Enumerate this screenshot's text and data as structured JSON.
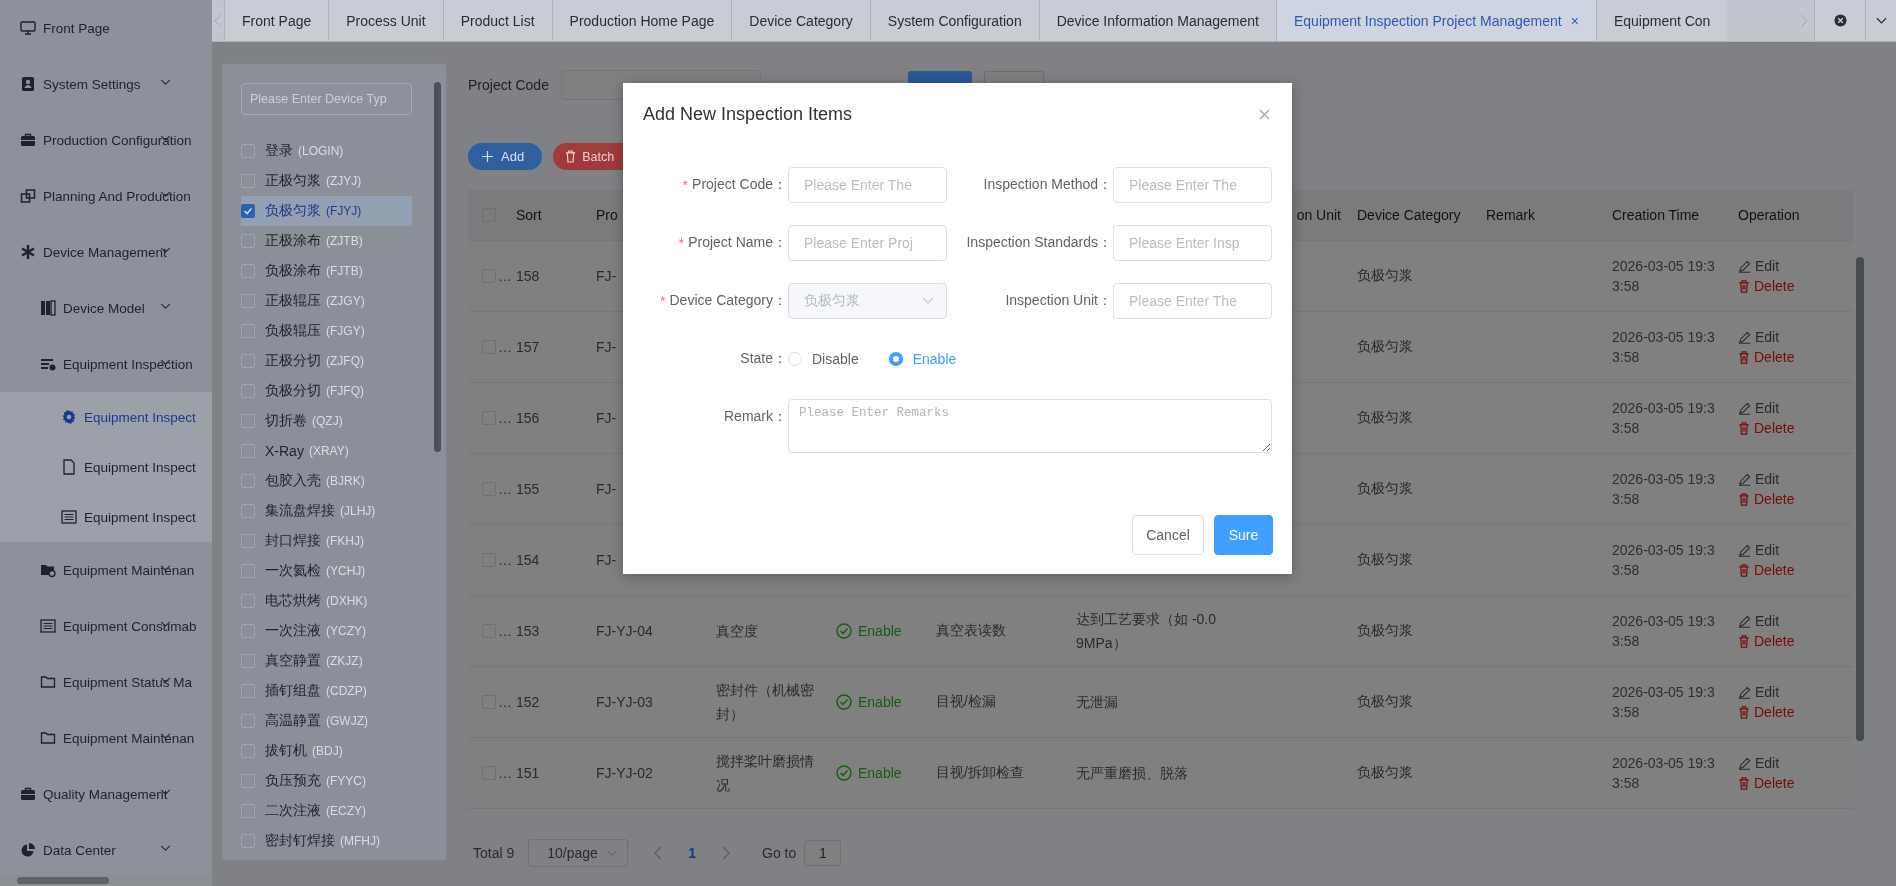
{
  "sidebar": {
    "items": [
      {
        "label": "Front Page",
        "selected": false,
        "expandable": false
      },
      {
        "label": "System Settings",
        "selected": false,
        "expandable": true
      },
      {
        "label": "Production Configuration",
        "selected": false,
        "expandable": true
      },
      {
        "label": "Planning And Production",
        "selected": false,
        "expandable": true
      },
      {
        "label": "Device Management",
        "selected": false,
        "expandable": true,
        "children": [
          {
            "label": "Device Model",
            "selected": false,
            "expandable": true
          },
          {
            "label": "Equipment Inspection",
            "selected": false,
            "expandable": true,
            "children": [
              {
                "label": "Equipment Inspect",
                "selected": true,
                "expandable": false
              },
              {
                "label": "Equipment Inspect",
                "selected": false,
                "expandable": false
              },
              {
                "label": "Equipment Inspect",
                "selected": false,
                "expandable": false
              }
            ]
          },
          {
            "label": "Equipment Maintenan",
            "selected": false,
            "expandable": true
          },
          {
            "label": "Equipment Consumab",
            "selected": false,
            "expandable": true
          },
          {
            "label": "Equipment Status Ma",
            "selected": false,
            "expandable": true
          },
          {
            "label": "Equipment Maintenan",
            "selected": false,
            "expandable": true
          }
        ]
      },
      {
        "label": "Quality Management",
        "selected": false,
        "expandable": true
      },
      {
        "label": "Data Center",
        "selected": false,
        "expandable": true
      }
    ]
  },
  "tabs": [
    {
      "label": "Front Page",
      "selected": false
    },
    {
      "label": "Process Unit",
      "selected": false
    },
    {
      "label": "Product List",
      "selected": false
    },
    {
      "label": "Production Home Page",
      "selected": false
    },
    {
      "label": "Device Category",
      "selected": false
    },
    {
      "label": "System Configuration",
      "selected": false
    },
    {
      "label": "Device Information Management",
      "selected": false
    },
    {
      "label": "Equipment Inspection Project Management",
      "selected": true,
      "close": "×"
    },
    {
      "label": "Equipment Con",
      "selected": false
    }
  ],
  "device_types": {
    "placeholder": "Please Enter Device Typ",
    "items": [
      {
        "name": "登录",
        "code": "(LOGIN)",
        "checked": false
      },
      {
        "name": "正极匀浆",
        "code": "(ZJYJ)",
        "checked": false
      },
      {
        "name": "负极匀浆",
        "code": "(FJYJ)",
        "checked": true
      },
      {
        "name": "正极涂布",
        "code": "(ZJTB)",
        "checked": false
      },
      {
        "name": "负极涂布",
        "code": "(FJTB)",
        "checked": false
      },
      {
        "name": "正极辊压",
        "code": "(ZJGY)",
        "checked": false
      },
      {
        "name": "负极辊压",
        "code": "(FJGY)",
        "checked": false
      },
      {
        "name": "正极分切",
        "code": "(ZJFQ)",
        "checked": false
      },
      {
        "name": "负极分切",
        "code": "(FJFQ)",
        "checked": false
      },
      {
        "name": "切折卷",
        "code": "(QZJ)",
        "checked": false
      },
      {
        "name": "X-Ray",
        "code": "(XRAY)",
        "checked": false
      },
      {
        "name": "包胶入壳",
        "code": "(BJRK)",
        "checked": false
      },
      {
        "name": "集流盘焊接",
        "code": "(JLHJ)",
        "checked": false
      },
      {
        "name": "封口焊接",
        "code": "(FKHJ)",
        "checked": false
      },
      {
        "name": "一次氦检",
        "code": "(YCHJ)",
        "checked": false
      },
      {
        "name": "电芯烘烤",
        "code": "(DXHK)",
        "checked": false
      },
      {
        "name": "一次注液",
        "code": "(YCZY)",
        "checked": false
      },
      {
        "name": "真空静置",
        "code": "(ZKJZ)",
        "checked": false
      },
      {
        "name": "插钉组盘",
        "code": "(CDZP)",
        "checked": false
      },
      {
        "name": "高温静置",
        "code": "(GWJZ)",
        "checked": false
      },
      {
        "name": "拔钉机",
        "code": "(BDJ)",
        "checked": false
      },
      {
        "name": "负压预充",
        "code": "(FYYC)",
        "checked": false
      },
      {
        "name": "二次注液",
        "code": "(ECZY)",
        "checked": false
      },
      {
        "name": "密封钉焊接",
        "code": "(MFHJ)",
        "checked": false
      }
    ]
  },
  "filter": {
    "label": "Project Code"
  },
  "toolbar": [
    {
      "label": "Add",
      "kind": "add"
    },
    {
      "label": "Batch",
      "kind": "delete"
    }
  ],
  "table": {
    "all_checked": false,
    "columns": {
      "sort": "Sort",
      "column_3": "Pro",
      "column_8": "on Unit",
      "device_category": "Device Category",
      "remark": "Remark",
      "creation_time": "Creation Time",
      "operation": "Operation"
    },
    "rows": [
      {
        "checked": false,
        "ellipsis": "…",
        "sort": "158",
        "project_code": "FJ-",
        "device_category": "负极匀浆",
        "creation_time": "2026-03-05 19:33:58",
        "actions": [
          {
            "label": "Edit",
            "kind": "edit"
          },
          {
            "label": "Delete",
            "kind": "delete"
          }
        ]
      },
      {
        "checked": false,
        "ellipsis": "…",
        "sort": "157",
        "project_code": "FJ-",
        "device_category": "负极匀浆",
        "creation_time": "2026-03-05 19:33:58",
        "actions": [
          {
            "label": "Edit",
            "kind": "edit"
          },
          {
            "label": "Delete",
            "kind": "delete"
          }
        ]
      },
      {
        "checked": false,
        "ellipsis": "…",
        "sort": "156",
        "project_code": "FJ-",
        "device_category": "负极匀浆",
        "creation_time": "2026-03-05 19:33:58",
        "actions": [
          {
            "label": "Edit",
            "kind": "edit"
          },
          {
            "label": "Delete",
            "kind": "delete"
          }
        ]
      },
      {
        "checked": false,
        "ellipsis": "…",
        "sort": "155",
        "project_code": "FJ-",
        "device_category": "负极匀浆",
        "creation_time": "2026-03-05 19:33:58",
        "actions": [
          {
            "label": "Edit",
            "kind": "edit"
          },
          {
            "label": "Delete",
            "kind": "delete"
          }
        ]
      },
      {
        "checked": false,
        "ellipsis": "…",
        "sort": "154",
        "project_code": "FJ-",
        "device_category": "负极匀浆",
        "creation_time": "2026-03-05 19:33:58",
        "actions": [
          {
            "label": "Edit",
            "kind": "edit"
          },
          {
            "label": "Delete",
            "kind": "delete"
          }
        ]
      },
      {
        "checked": false,
        "ellipsis": "…",
        "sort": "153",
        "project_code": "FJ-YJ-04",
        "project_name": "真空度",
        "state": {
          "label": "Enable",
          "enabled": true
        },
        "inspection_method": "真空表读数",
        "inspection_standards": "达到工艺要求（如 -0.09MPa）",
        "device_category": "负极匀浆",
        "creation_time": "2026-03-05 19:33:58",
        "actions": [
          {
            "label": "Edit",
            "kind": "edit"
          },
          {
            "label": "Delete",
            "kind": "delete"
          }
        ]
      },
      {
        "checked": false,
        "ellipsis": "…",
        "sort": "152",
        "project_code": "FJ-YJ-03",
        "project_name": "密封件（机械密封）",
        "state": {
          "label": "Enable",
          "enabled": true
        },
        "inspection_method": "目视/检漏",
        "inspection_standards": "无泄漏",
        "device_category": "负极匀浆",
        "creation_time": "2026-03-05 19:33:58",
        "actions": [
          {
            "label": "Edit",
            "kind": "edit"
          },
          {
            "label": "Delete",
            "kind": "delete"
          }
        ]
      },
      {
        "checked": false,
        "ellipsis": "…",
        "sort": "151",
        "project_code": "FJ-YJ-02",
        "project_name": "搅拌桨叶磨损情况",
        "state": {
          "label": "Enable",
          "enabled": true
        },
        "inspection_method": "目视/拆卸检查",
        "inspection_standards": "无严重磨损、脱落",
        "device_category": "负极匀浆",
        "creation_time": "2026-03-05 19:33:58",
        "actions": [
          {
            "label": "Edit",
            "kind": "edit"
          },
          {
            "label": "Delete",
            "kind": "delete"
          }
        ]
      }
    ]
  },
  "pagination": {
    "total": "Total 9",
    "page_size": "10/page",
    "pages": [
      {
        "label": "1",
        "selected": true
      }
    ],
    "goto_label": "Go to",
    "goto_value": "1"
  },
  "dialog": {
    "title": "Add New Inspection Items",
    "fields": [
      {
        "kind": "input",
        "mark": "*",
        "label": "Project Code：",
        "placeholder": "Please Enter The"
      },
      {
        "kind": "input",
        "label": "Inspection Method：",
        "placeholder": "Please Enter The"
      },
      {
        "kind": "input",
        "mark": "*",
        "label": "Project Name：",
        "placeholder": "Please Enter Proj"
      },
      {
        "kind": "input",
        "label": "Inspection Standards：",
        "placeholder": "Please Enter Insp"
      },
      {
        "kind": "select",
        "mark": "*",
        "label": "Device Category：",
        "value": "负极匀浆",
        "disabled": true
      },
      {
        "kind": "input",
        "label": "Inspection Unit：",
        "placeholder": "Please Enter The"
      },
      {
        "kind": "radio",
        "label": "State：",
        "options": [
          {
            "label": "Disable",
            "selected": false
          },
          {
            "label": "Enable",
            "selected": true
          }
        ]
      },
      {
        "kind": "textarea",
        "label": "Remark：",
        "placeholder": "Please Enter Remarks"
      }
    ],
    "buttons": [
      {
        "label": "Cancel",
        "kind": "default"
      },
      {
        "label": "Sure",
        "kind": "primary"
      }
    ]
  }
}
